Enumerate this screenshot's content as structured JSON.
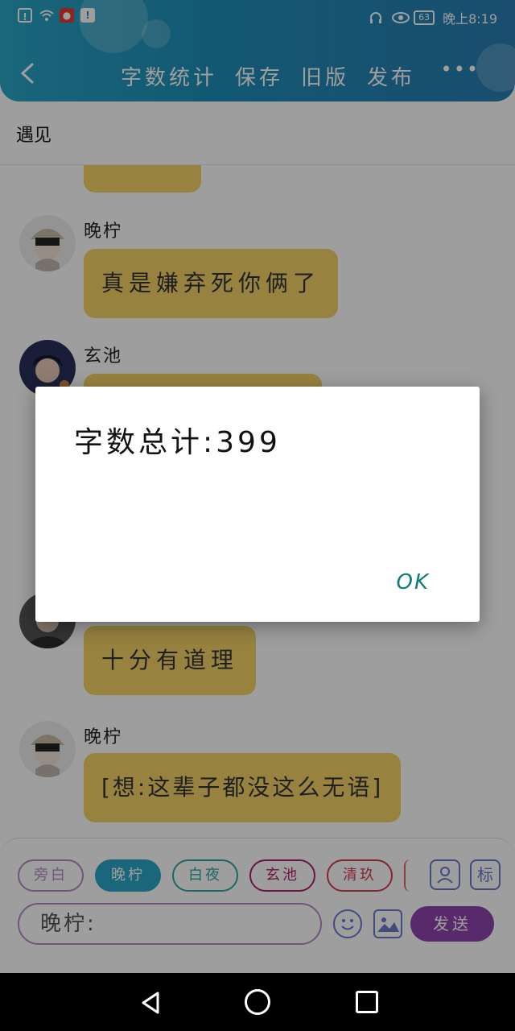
{
  "status_bar": {
    "time": "晚上8:19",
    "battery": "63"
  },
  "toolbar": {
    "word_count_label": "字数统计",
    "save_label": "保存",
    "old_version_label": "旧版",
    "publish_label": "发布",
    "more_label": "•••"
  },
  "chat": {
    "title": "遇见",
    "messages": [
      {
        "name": "",
        "text": "",
        "avatar": ""
      },
      {
        "name": "晚柠",
        "text": "真是嫌弃死你俩了",
        "avatar": "boy-cap"
      },
      {
        "name": "玄池",
        "text": "",
        "avatar": "boy-night"
      },
      {
        "name": "",
        "text": "十分有道理",
        "avatar": "boy-dark"
      },
      {
        "name": "晚柠",
        "text": "[想:这辈子都没这么无语]",
        "avatar": "boy-cap"
      }
    ]
  },
  "composer": {
    "chips": [
      {
        "label": "旁白",
        "color": "#b58cc3",
        "active": false
      },
      {
        "label": "晚柠",
        "color": "#2aa6c7",
        "active": true
      },
      {
        "label": "白夜",
        "color": "#2aa6a0",
        "active": false
      },
      {
        "label": "玄池",
        "color": "#b0206a",
        "active": false
      },
      {
        "label": "清玖",
        "color": "#d33a55",
        "active": false
      }
    ],
    "input_value": "晚柠:",
    "send_label": "发送",
    "tag_label": "标"
  },
  "dialog": {
    "message": "字数总计:399",
    "ok_label": "OK"
  },
  "colors": {
    "header": "#1f8fb9",
    "bubble": "#f4d266",
    "send": "#8e44ad",
    "ok": "#0d7d7a"
  }
}
